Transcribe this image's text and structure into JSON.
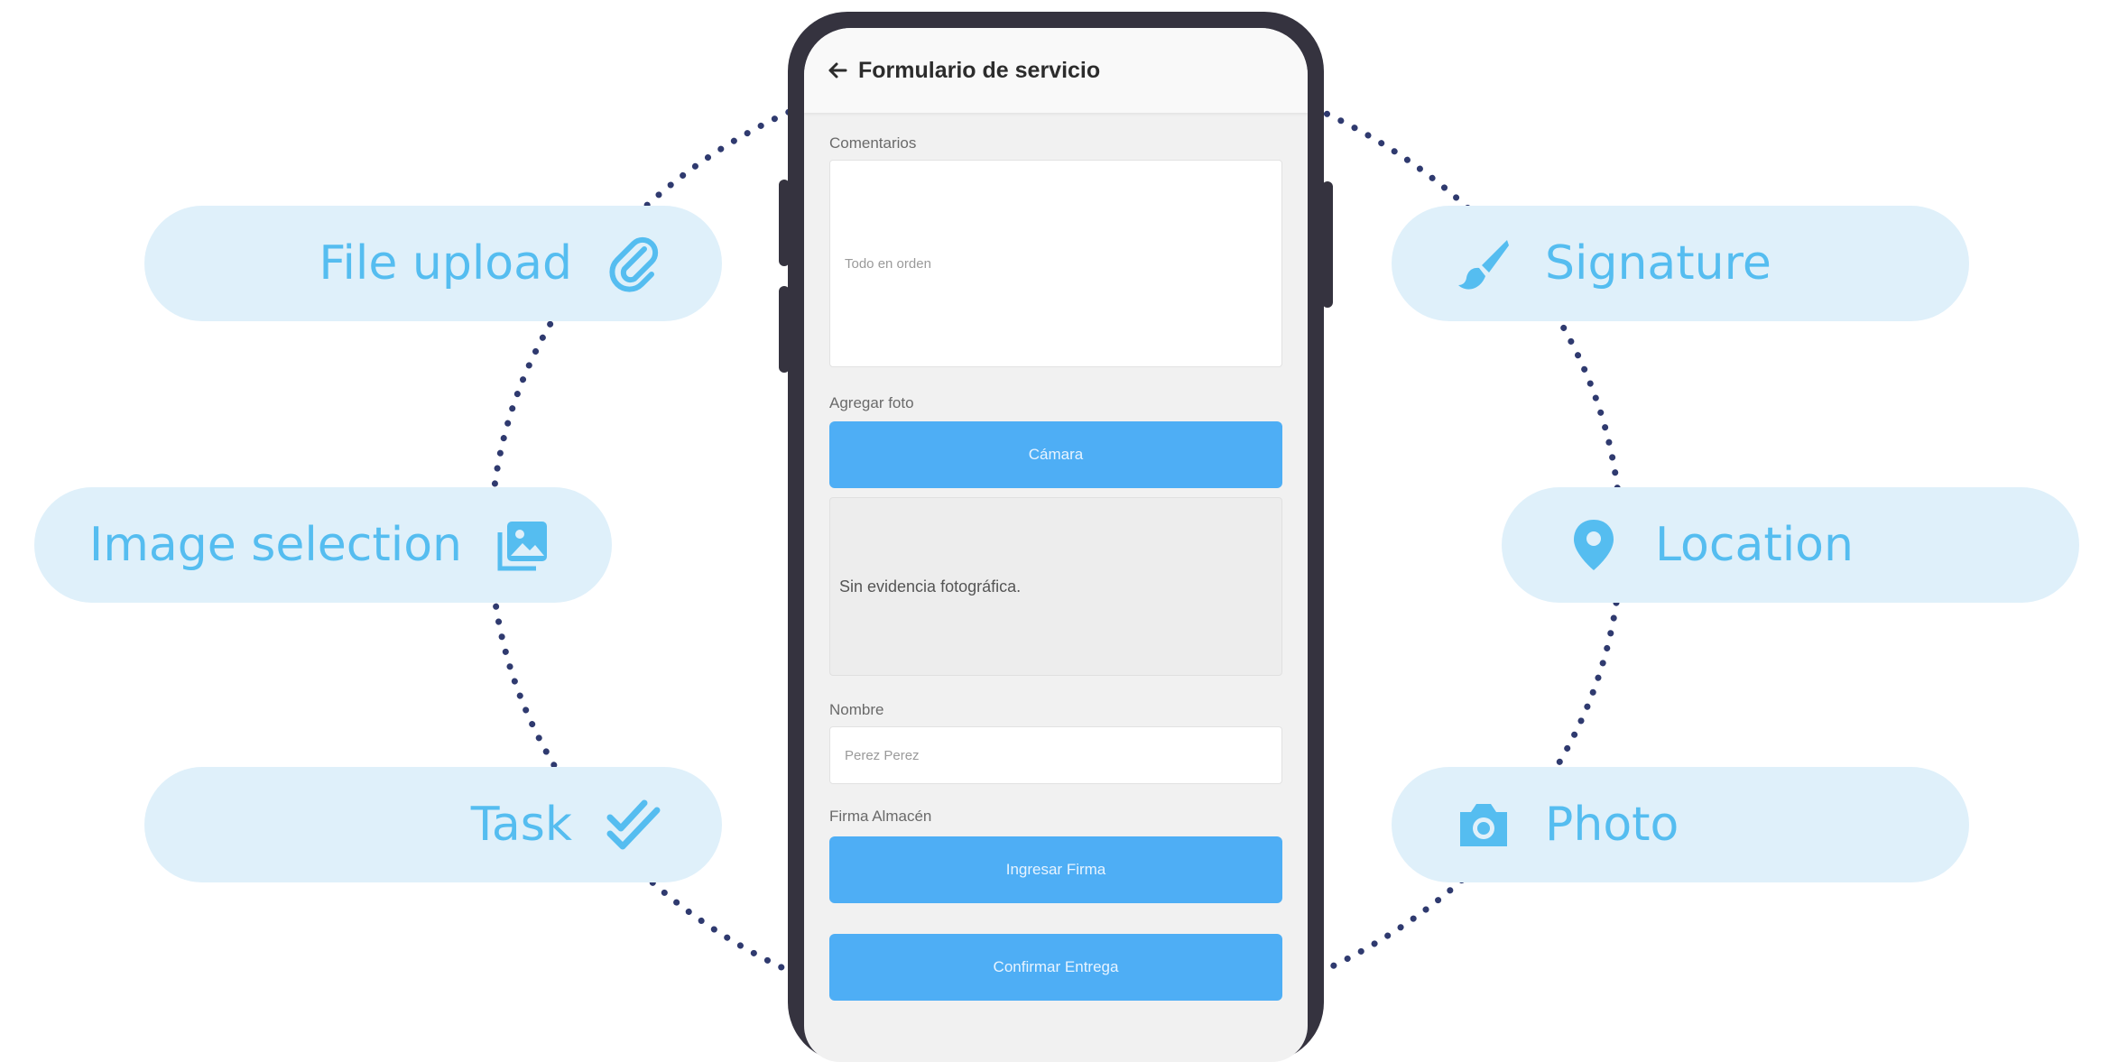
{
  "colors": {
    "pill_background": "#dff0fa",
    "pill_text": "#55bdf0",
    "ring_dots": "#2f3a6f",
    "phone_frame": "#35333f",
    "primary_button": "#4eaef5"
  },
  "features": {
    "left": [
      {
        "label": "File upload",
        "icon": "paperclip-icon"
      },
      {
        "label": "Image selection",
        "icon": "image-gallery-icon"
      },
      {
        "label": "Task",
        "icon": "double-check-icon"
      }
    ],
    "right": [
      {
        "label": "Signature",
        "icon": "pen-brush-icon"
      },
      {
        "label": "Location",
        "icon": "map-pin-icon"
      },
      {
        "label": "Photo",
        "icon": "camera-icon"
      }
    ]
  },
  "phone": {
    "header": {
      "title": "Formulario de servicio",
      "back_icon": "back-arrow-icon"
    },
    "comments": {
      "label": "Comentarios",
      "value": "Todo en orden"
    },
    "photo": {
      "label": "Agregar foto",
      "camera_button": "Cámara",
      "empty_text": "Sin evidencia fotográfica."
    },
    "name": {
      "label": "Nombre",
      "value": "Perez Perez"
    },
    "signature": {
      "label": "Firma Almacén",
      "button": "Ingresar Firma"
    },
    "confirm_button": "Confirmar Entrega"
  }
}
